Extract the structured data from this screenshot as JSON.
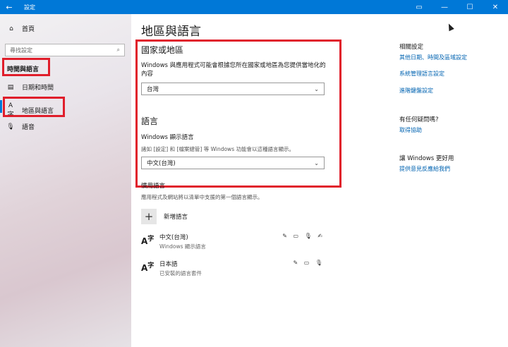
{
  "window": {
    "title": "設定",
    "back_icon": "←",
    "minimize_icon": "—",
    "maximize_icon": "☐",
    "close_icon": "✕",
    "extra_icon": "▭"
  },
  "sidebar": {
    "home_icon": "⌂",
    "home_label": "首頁",
    "search_placeholder": "尋找設定",
    "search_icon": "⌕",
    "section": "時間與語言",
    "items": [
      {
        "icon": "▤",
        "label": "日期和時間"
      },
      {
        "icon": "A字",
        "label": "地區與語言"
      },
      {
        "icon": "🎙",
        "label": "語音"
      }
    ]
  },
  "main": {
    "title": "地區與語言",
    "country_heading": "國家或地區",
    "country_desc": "Windows 與應用程式可能會根據您所在國家或地區為您提供當地化的內容",
    "country_value": "台灣",
    "language_heading": "語言",
    "display_lang_label": "Windows 顯示語言",
    "display_lang_desc": "諸如 [設定] 和 [檔案總管] 等 Windows 功能會以這種語言顯示。",
    "display_lang_value": "中文(台灣)",
    "preferred_heading": "慣用語言",
    "preferred_desc": "應用程式及網站將以清單中支援的第一個語言顯示。",
    "add_label": "新增語言",
    "languages": [
      {
        "name": "中文(台灣)",
        "sub": "Windows 顯示語言",
        "icons": "✎ ▭ 🎙 ✍"
      },
      {
        "name": "日本語",
        "sub": "已安裝的語言套件",
        "icons": "✎ ▭ 🎙"
      }
    ]
  },
  "related": {
    "heading": "相關設定",
    "links": [
      "其他日期、時間及區域設定",
      "系統管理語言設定",
      "進階鍵盤設定"
    ],
    "question": "有任何疑問嗎?",
    "help_link": "取得協助",
    "improve": "讓 Windows 更好用",
    "feedback_link": "提供意見反應給我們"
  }
}
